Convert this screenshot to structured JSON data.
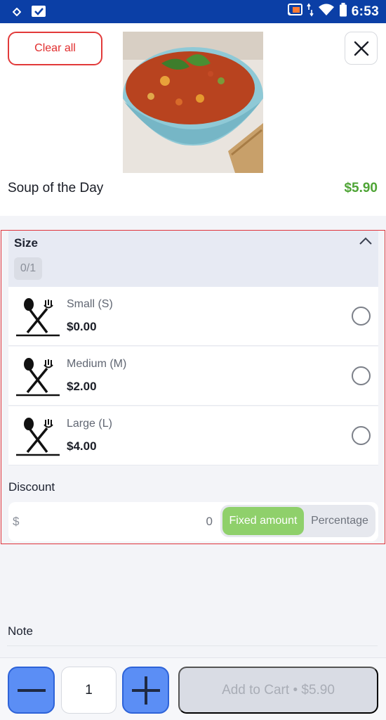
{
  "status_bar": {
    "time": "6:53",
    "icons": [
      "notification-diamond-icon",
      "checkbox-app-icon",
      "cast-icon",
      "data-arrows-icon",
      "wifi-icon",
      "battery-icon"
    ]
  },
  "header": {
    "clear_label": "Clear all",
    "close_icon": "close-icon",
    "item_name": "Soup of the Day",
    "item_price": "$5.90"
  },
  "size_group": {
    "title": "Size",
    "counter": "0/1",
    "options": [
      {
        "label": "Small (S)",
        "price": "$0.00",
        "icon": "utensils-icon",
        "selected": false
      },
      {
        "label": "Medium (M)",
        "price": "$2.00",
        "icon": "utensils-icon",
        "selected": false
      },
      {
        "label": "Large (L)",
        "price": "$4.00",
        "icon": "utensils-icon",
        "selected": false
      }
    ]
  },
  "discount": {
    "title": "Discount",
    "currency": "$",
    "value": "0",
    "fixed_label": "Fixed amount",
    "percentage_label": "Percentage",
    "active_mode": "fixed"
  },
  "note": {
    "title": "Note"
  },
  "cart": {
    "quantity": "1",
    "add_label": "Add to Cart • $5.90"
  },
  "colors": {
    "status_bar": "#0b3fa6",
    "price_green": "#4ea435",
    "clear_red": "#e12d2d",
    "fixed_green": "#8fd06b",
    "qty_blue": "#5b8ef5"
  }
}
